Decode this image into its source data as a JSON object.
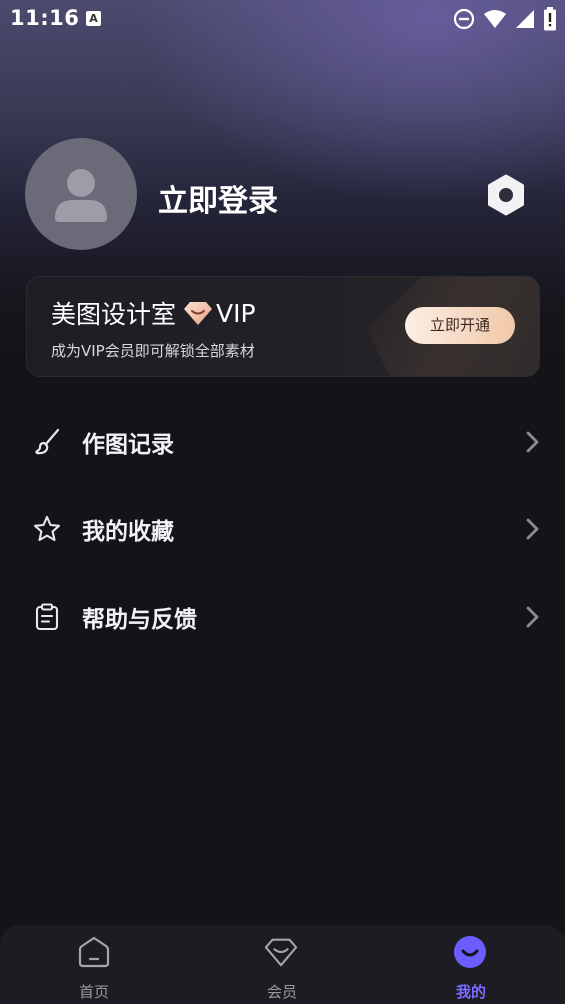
{
  "status_bar": {
    "time": "11:16",
    "notification_badge": "A",
    "icons": [
      "do-not-disturb-icon",
      "wifi-icon",
      "signal-icon",
      "battery-icon"
    ]
  },
  "profile": {
    "login_label": "立即登录",
    "avatar_icon": "person-icon",
    "settings_icon": "hexagon-gear-icon"
  },
  "vip_card": {
    "brand": "美图设计室",
    "vip_label": "VIP",
    "subtitle": "成为VIP会员即可解锁全部素材",
    "cta_label": "立即开通",
    "accent_color": "#f1c8a8"
  },
  "menu": {
    "items": [
      {
        "label": "作图记录",
        "icon": "brush-icon"
      },
      {
        "label": "我的收藏",
        "icon": "star-icon"
      },
      {
        "label": "帮助与反馈",
        "icon": "clipboard-icon"
      }
    ]
  },
  "bottom_nav": {
    "active_color": "#7a6dff",
    "items": [
      {
        "label": "首页",
        "icon": "home-icon",
        "active": false
      },
      {
        "label": "会员",
        "icon": "diamond-icon",
        "active": false
      },
      {
        "label": "我的",
        "icon": "smile-icon",
        "active": true
      }
    ]
  }
}
